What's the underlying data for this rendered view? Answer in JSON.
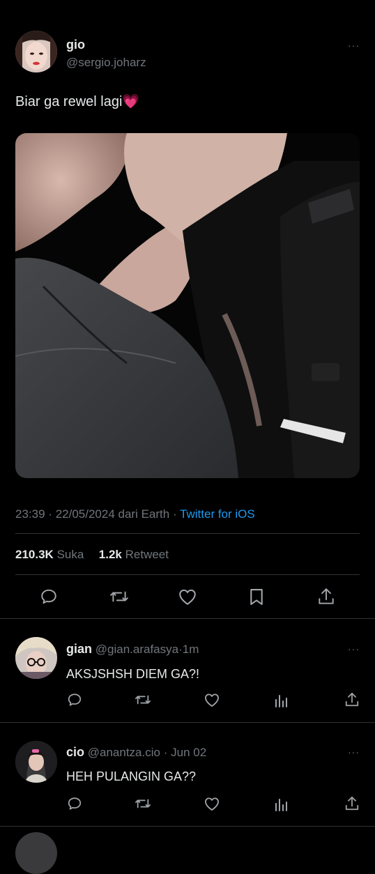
{
  "tweet": {
    "author_name": "gio",
    "author_handle": "@sergio.joharz",
    "text": "Biar ga rewel lagi💗",
    "time": "23:39",
    "date": "22/05/2024",
    "location": "dari Earth",
    "source": "Twitter for iOS",
    "likes_count": "210.3K",
    "likes_label": "Suka",
    "retweets_count": "1.2k",
    "retweets_label": "Retweet",
    "more_glyph": "···",
    "dot": "·"
  },
  "actions": [
    "reply-icon",
    "retweet-icon",
    "like-icon",
    "bookmark-icon",
    "share-icon"
  ],
  "replies": [
    {
      "name": "gian",
      "handle": "@gian.arafasya",
      "time": "1m",
      "text": "AKSJSHSH DIEM GA?!"
    },
    {
      "name": "cio",
      "handle": "@anantza.cio",
      "time": "Jun 02",
      "text": "HEH PULANGIN GA??"
    }
  ],
  "colors": {
    "background": "#000000",
    "text": "#e7e9ea",
    "muted": "#71767b",
    "link": "#1d9bf0",
    "divider": "#2f3336"
  }
}
